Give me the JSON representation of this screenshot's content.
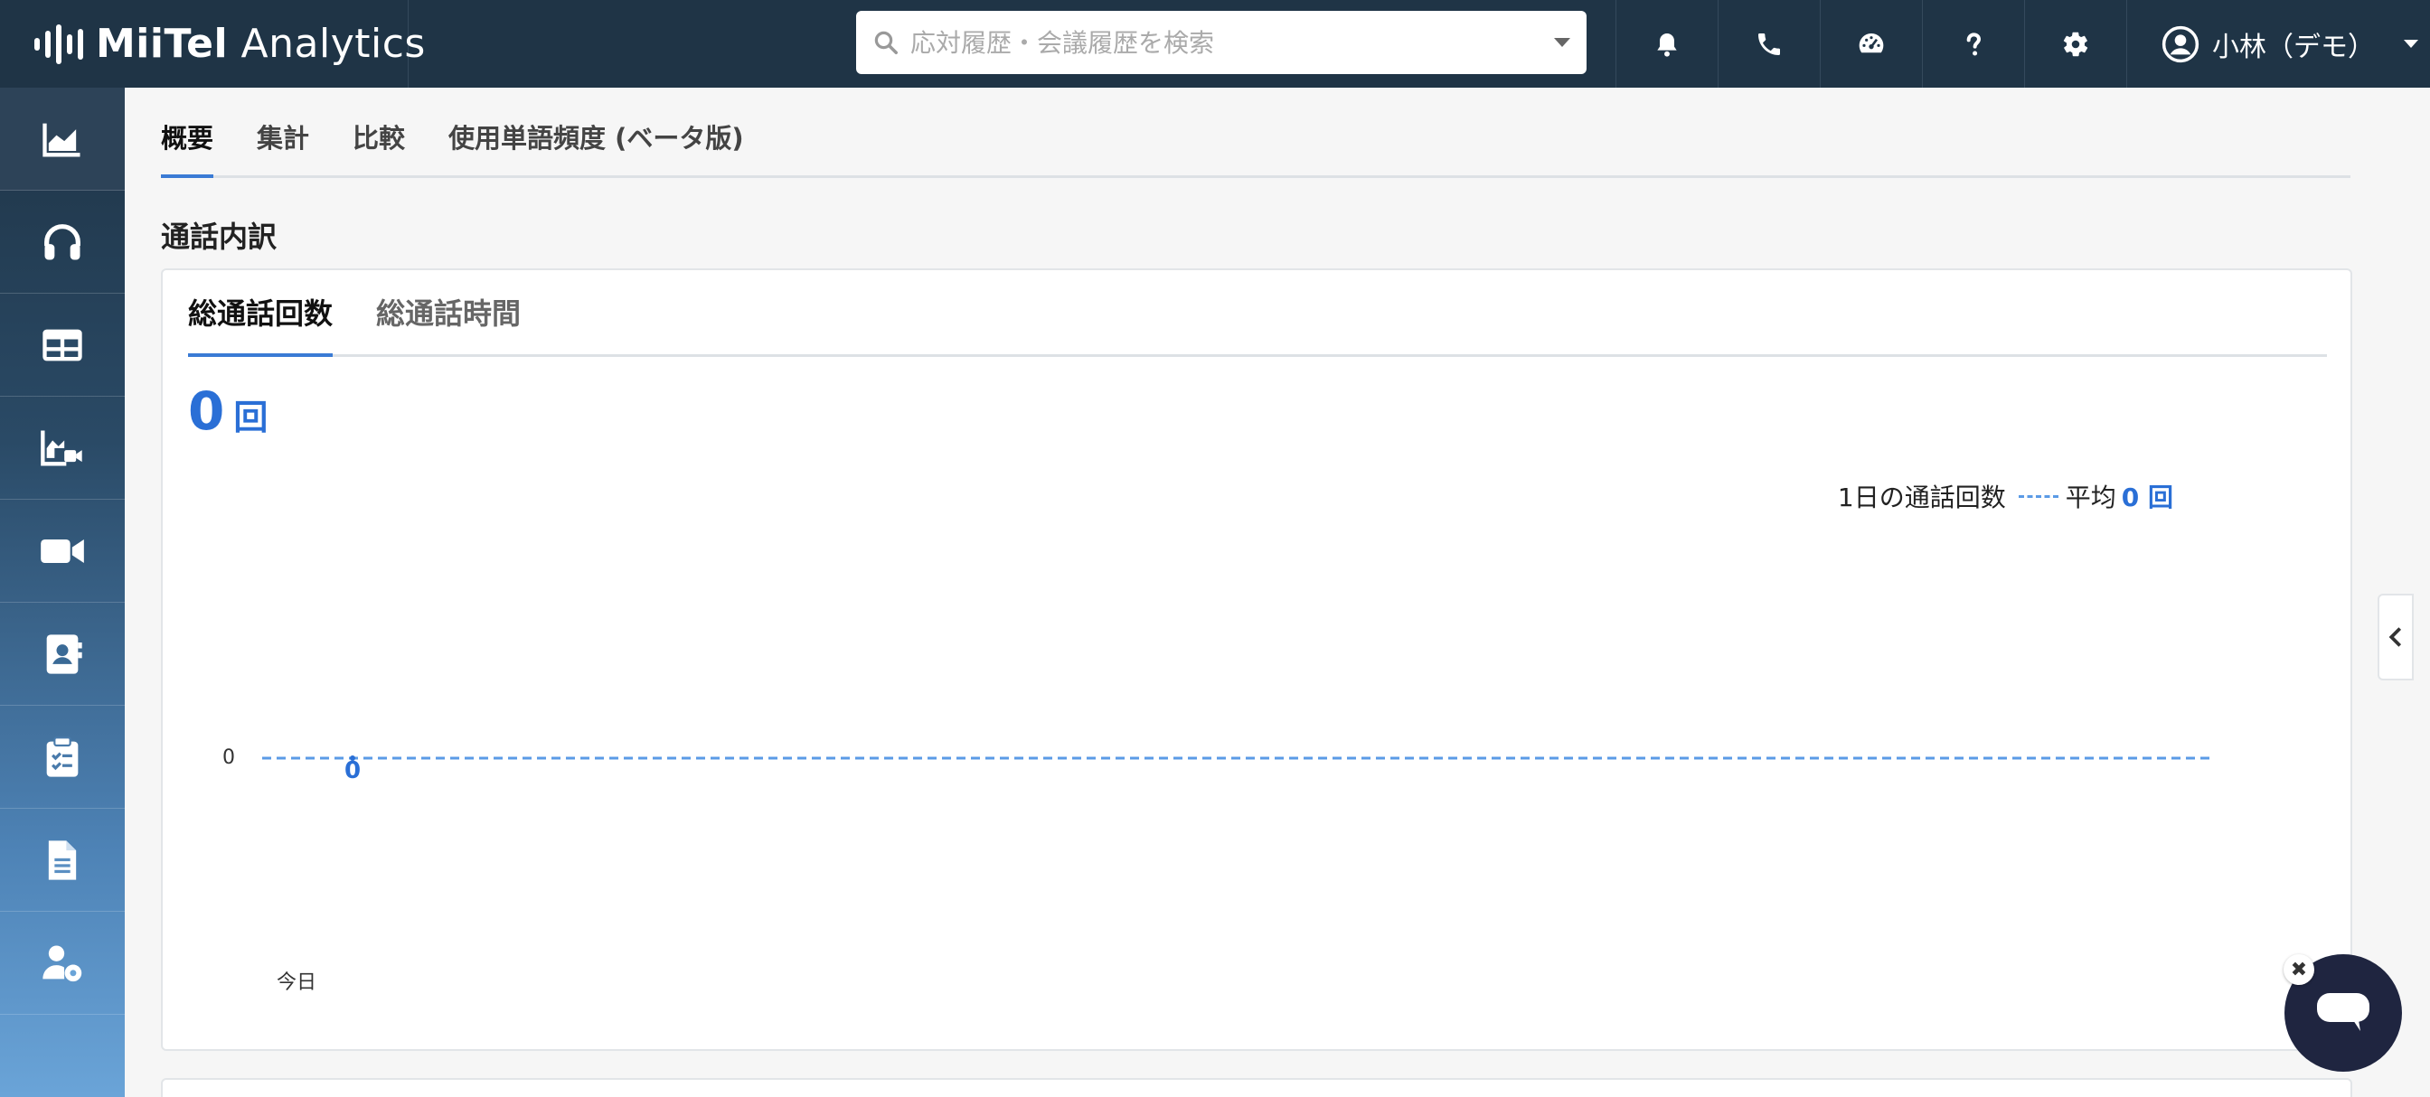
{
  "app": {
    "brand_bold": "MiiTel",
    "brand_rest": " Analytics"
  },
  "search": {
    "placeholder": "応対履歴・会議履歴を検索",
    "value": ""
  },
  "top_icons": [
    "bell-icon",
    "phone-icon",
    "dashboard-icon",
    "question-icon",
    "gear-icon"
  ],
  "user": {
    "name": "小林（デモ）"
  },
  "sidebar": {
    "items": [
      "analytics-chart-icon",
      "headset-icon",
      "table-icon",
      "chart-video-icon",
      "video-camera-icon",
      "contact-book-icon",
      "clipboard-icon",
      "document-icon",
      "user-settings-icon"
    ]
  },
  "tabs": [
    {
      "label": "概要",
      "active": true
    },
    {
      "label": "集計",
      "active": false
    },
    {
      "label": "比較",
      "active": false
    },
    {
      "label": "使用単語頻度 (ベータ版)",
      "active": false
    }
  ],
  "section": {
    "title": "通話内訳"
  },
  "card": {
    "tabs": [
      {
        "label": "総通話回数",
        "active": true
      },
      {
        "label": "総通話時間",
        "active": false
      }
    ],
    "total_value": "0",
    "total_unit": "回",
    "legend": {
      "series_label": "1日の通話回数",
      "avg_label": "平均",
      "avg_value": "0 回"
    }
  },
  "chart_data": {
    "type": "line",
    "categories": [
      "今日"
    ],
    "series": [
      {
        "name": "1日の通話回数",
        "values": [
          0
        ]
      }
    ],
    "average": 0,
    "y_ticks": [
      "0"
    ],
    "data_labels": [
      "0"
    ],
    "xlabel": "",
    "ylabel": ""
  },
  "colors": {
    "accent": "#2a6fd6",
    "topbar": "#1f3446",
    "avg_line": "#5b9be6"
  }
}
